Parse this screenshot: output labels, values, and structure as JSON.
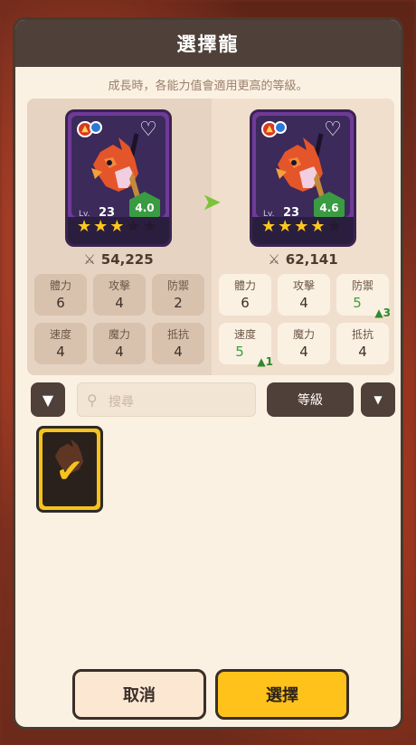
{
  "header": {
    "title": "選擇龍"
  },
  "subtitle": "成長時，各能力值會適用更高的等級。",
  "current": {
    "level_label": "Lv.",
    "level": "23",
    "grade": "4.0",
    "stars_filled": 3,
    "stars_total": 5,
    "power": "54,225",
    "stats": [
      {
        "label": "體力",
        "value": "6"
      },
      {
        "label": "攻擊",
        "value": "4"
      },
      {
        "label": "防禦",
        "value": "2"
      },
      {
        "label": "速度",
        "value": "4"
      },
      {
        "label": "魔力",
        "value": "4"
      },
      {
        "label": "抵抗",
        "value": "4"
      }
    ]
  },
  "after": {
    "level_label": "Lv.",
    "level": "23",
    "grade": "4.6",
    "stars_filled": 4,
    "stars_total": 5,
    "power": "62,141",
    "stats": [
      {
        "label": "體力",
        "value": "6"
      },
      {
        "label": "攻擊",
        "value": "4"
      },
      {
        "label": "防禦",
        "value": "5",
        "boost": "3"
      },
      {
        "label": "速度",
        "value": "5",
        "boost": "1"
      },
      {
        "label": "魔力",
        "value": "4"
      },
      {
        "label": "抵抗",
        "value": "4"
      }
    ]
  },
  "toolbar": {
    "search_placeholder": "搜尋",
    "sort_label": "等級"
  },
  "buttons": {
    "cancel": "取消",
    "select": "選擇"
  },
  "colors": {
    "header": "#4f4039",
    "panel": "#fbf1e2",
    "accent": "#ffc21a",
    "up": "#38a23a"
  },
  "icons": [
    "fire-element-icon",
    "water-element-icon",
    "heart-icon",
    "arrow-right-icon",
    "sword-power-icon",
    "filter-icon",
    "search-icon",
    "caret-down-icon",
    "check-icon"
  ]
}
